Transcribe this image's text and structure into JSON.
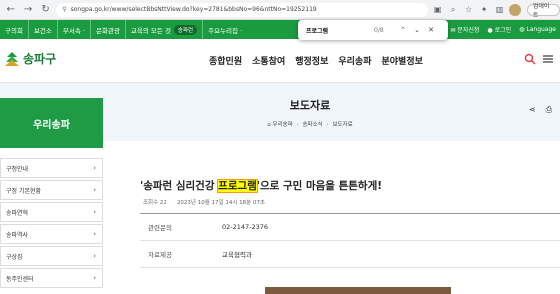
{
  "browser": {
    "url": "songpa.go.kr/www/selectBbsNttView.do?key=2781&bbsNo=96&nttNo=19252119",
    "update_label": "업데이트"
  },
  "findbar": {
    "query": "프로그램",
    "count": "0/8"
  },
  "topbar": {
    "tabs": [
      "구의회",
      "보건소",
      "부서속 ·",
      "문화관광",
      "교육의 모든 것"
    ],
    "tab_badge": "송파런",
    "extra": "주요누리집 ·",
    "right": [
      "문자신청",
      "로그인",
      "Language"
    ]
  },
  "header": {
    "logo_text": "송파구",
    "nav": [
      "종합민원",
      "소통참여",
      "행정정보",
      "우리송파",
      "분야별정보"
    ]
  },
  "visual": {
    "section_title": "우리송파",
    "page_title": "보도자료",
    "breadcrumb": [
      "우리송파",
      "송파소식",
      "보도자료"
    ]
  },
  "sidemenu": [
    "구청안내",
    "구정 기본현황",
    "송파연혁",
    "송파역사",
    "구상징",
    "동주민센터"
  ],
  "article": {
    "title_prefix": "'송파런 심리건강 ",
    "title_highlight": "프로그램",
    "title_suffix": "'으로 구민 마음을 튼튼하게!",
    "views": "조회수 22",
    "date": "2023년 10월 17일 14시 18분 07초",
    "rows": [
      {
        "label": "관련문의",
        "value": "02-2147-2376"
      },
      {
        "label": "자료제공",
        "value": "교육협력과"
      }
    ]
  },
  "colors": {
    "brand_green": "#1a9b40",
    "side_green": "#1f9a45",
    "highlight": "#ffff00"
  }
}
